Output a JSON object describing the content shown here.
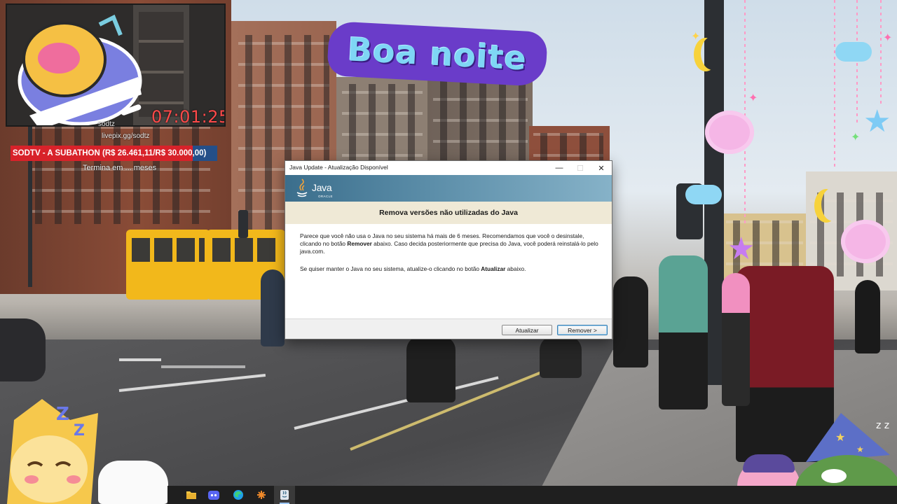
{
  "stream": {
    "timer": "07:01:25",
    "social_handle": "sodtz",
    "social_link": "livepix.gg/sodtz",
    "subathon_label": "SODTV - A SUBATHON (R$ 26.461,11/R$ 30.000,00)",
    "subathon_progress": 0.882,
    "termina_text": "Termina em ... meses",
    "greeting": "Boa noite"
  },
  "dialog": {
    "title": "Java Update - Atualização Disponível",
    "logo_word": "Java",
    "logo_sub": "ORACLE",
    "heading": "Remova versões não utilizadas do Java",
    "paragraph1": {
      "part1": "Parece que você não usa o Java no seu sistema há mais de 6 meses. Recomendamos que você o desinstale, clicando no botão ",
      "bold": "Remover",
      "part2": " abaixo. Caso decida posteriormente que precisa do Java, você poderá reinstalá-lo pelo java.com."
    },
    "paragraph2": {
      "part1": "Se quiser manter o Java no seu sistema, atualize-o clicando no botão ",
      "bold": "Atualizar",
      "part2": " abaixo."
    },
    "buttons": {
      "update": "Atualizar",
      "remove": "Remover >"
    },
    "window_controls": {
      "minimize": "—",
      "maximize": "☐",
      "close": "✕"
    }
  },
  "taskbar": {
    "icons": [
      "explorer-icon",
      "discord-icon",
      "edge-icon",
      "app-icon",
      "java-update-icon"
    ]
  },
  "colors": {
    "subathon_red": "#d8222a",
    "subathon_blue": "#244f89",
    "timer_red": "#ff4a4a",
    "java_header": "#3b6e8c"
  }
}
